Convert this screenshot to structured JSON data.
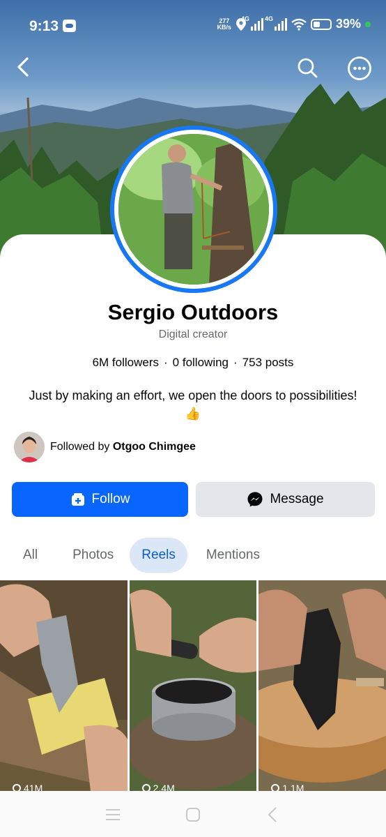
{
  "status_bar": {
    "time": "9:13",
    "net_speed": "277",
    "net_unit": "KB/s",
    "sim1": "4G",
    "sim2": "4G",
    "battery": "39%"
  },
  "profile": {
    "name": "Sergio Outdoors",
    "category": "Digital creator",
    "followers": "6M followers",
    "following": "0 following",
    "posts": "753 posts",
    "separator": "·",
    "bio": "Just by making an effort, we open the doors to possibilities!",
    "bio_emoji": "👍",
    "followed_by_prefix": "Followed by",
    "followed_by_name": "Otgoo Chimgee"
  },
  "actions": {
    "follow_label": "Follow",
    "message_label": "Message"
  },
  "tabs": [
    {
      "label": "All",
      "active": false
    },
    {
      "label": "Photos",
      "active": false
    },
    {
      "label": "Reels",
      "active": true
    },
    {
      "label": "Mentions",
      "active": false
    }
  ],
  "reels": [
    {
      "views": "41M"
    },
    {
      "views": "2.4M"
    },
    {
      "views": "1.1M"
    }
  ],
  "colors": {
    "accent": "#0866ff",
    "active_tab_bg": "#dbe7f7",
    "active_tab_text": "#0a5cc9",
    "secondary_button": "#e4e6eb",
    "muted_text": "#65676b"
  },
  "icons": {
    "back": "chevron-left-icon",
    "search": "search-icon",
    "more": "more-horizontal-icon",
    "follow": "add-friend-icon",
    "message": "messenger-icon",
    "views": "play-icon"
  }
}
